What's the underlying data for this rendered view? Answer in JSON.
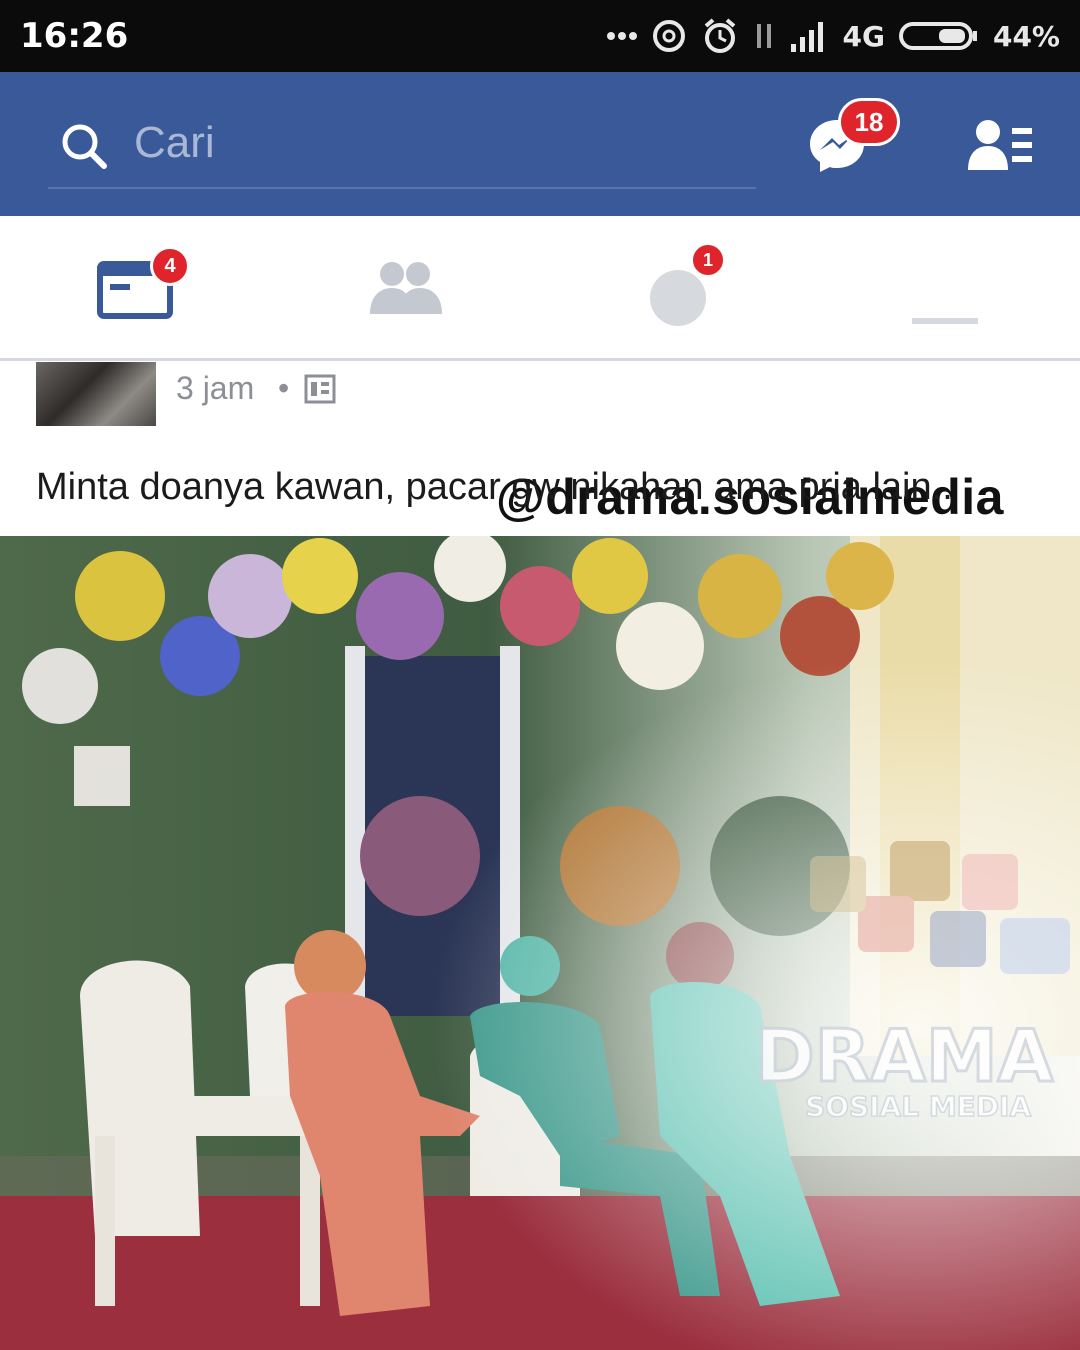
{
  "status_bar": {
    "time": "16:26",
    "network": "4G",
    "battery": "44%",
    "icons": [
      "more-dots-icon",
      "sync-icon",
      "alarm-icon",
      "data-arrows-icon",
      "signal-icon",
      "battery-icon"
    ]
  },
  "top_bar": {
    "search_placeholder": "Cari",
    "messenger_badge": "18",
    "color": "#3b5998"
  },
  "tabs": {
    "feed_badge": "4",
    "notifications_badge": "1",
    "items": [
      "news-feed-icon",
      "friends-icon",
      "globe-icon",
      "menu-icon"
    ]
  },
  "watermark": {
    "handle": "@drama.sosialmedia",
    "logo_text": "DRAMA",
    "logo_subtext": "SOSIAL MEDIA"
  },
  "post": {
    "time": "3 jam",
    "separator": "•",
    "text": "Minta doanya kawan, pacar gw nikahan ama pria lain.."
  }
}
